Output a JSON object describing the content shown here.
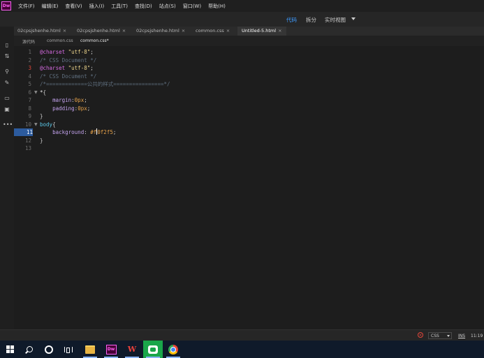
{
  "app": {
    "logo_text": "Dw"
  },
  "menubar": {
    "items": [
      "文件(F)",
      "编辑(E)",
      "查看(V)",
      "插入(I)",
      "工具(T)",
      "查找(D)",
      "站点(S)",
      "窗口(W)",
      "帮助(H)"
    ]
  },
  "viewbar": {
    "code_label": "代码",
    "split_label": "拆分",
    "live_label": "实时视图"
  },
  "tabs": [
    {
      "label": "02cpsjshenhe.html",
      "active": false
    },
    {
      "label": "02cpsjshenhe.html",
      "active": false
    },
    {
      "label": "02cpsjshenhe.html",
      "active": false
    },
    {
      "label": "common.css",
      "active": false
    },
    {
      "label": "Untitled-5.html",
      "active": true
    }
  ],
  "tab_close_glyph": "×",
  "related_files": {
    "source_label": "源代码",
    "items": [
      "common.css",
      "common.css*"
    ],
    "active_index": 1
  },
  "editor": {
    "current_line": 11,
    "error_line": 3,
    "lines": [
      {
        "num": "1",
        "fold": "",
        "parts": [
          [
            "c-at",
            "@charset"
          ],
          [
            "c-punc",
            " "
          ],
          [
            "c-str",
            "\"utf-8\""
          ],
          [
            "c-punc",
            ";"
          ]
        ]
      },
      {
        "num": "2",
        "fold": "",
        "parts": [
          [
            "c-com",
            "/* CSS Document */"
          ]
        ]
      },
      {
        "num": "3",
        "fold": "",
        "parts": [
          [
            "c-at",
            "@charset"
          ],
          [
            "c-punc",
            " "
          ],
          [
            "c-str",
            "\"utf-8\""
          ],
          [
            "c-punc",
            ";"
          ]
        ]
      },
      {
        "num": "4",
        "fold": "",
        "parts": [
          [
            "c-com",
            "/* CSS Document */"
          ]
        ]
      },
      {
        "num": "5",
        "fold": "",
        "parts": [
          [
            "c-com",
            "/*=============公共的样式================*/"
          ]
        ]
      },
      {
        "num": "6",
        "fold": "▼",
        "parts": [
          [
            "c-sel",
            "*"
          ],
          [
            "c-punc",
            "{"
          ]
        ]
      },
      {
        "num": "7",
        "fold": "",
        "parts": [
          [
            "c-punc",
            "    "
          ],
          [
            "c-prop",
            "margin"
          ],
          [
            "c-punc",
            ":"
          ],
          [
            "c-val",
            "0px"
          ],
          [
            "c-punc",
            ";"
          ]
        ]
      },
      {
        "num": "8",
        "fold": "",
        "parts": [
          [
            "c-punc",
            "    "
          ],
          [
            "c-prop",
            "padding"
          ],
          [
            "c-punc",
            ":"
          ],
          [
            "c-val",
            "0px"
          ],
          [
            "c-punc",
            ";"
          ]
        ]
      },
      {
        "num": "9",
        "fold": "",
        "parts": [
          [
            "c-punc",
            "}"
          ]
        ]
      },
      {
        "num": "10",
        "fold": "▼",
        "parts": [
          [
            "c-tag",
            "body"
          ],
          [
            "c-punc",
            "{"
          ]
        ]
      },
      {
        "num": "11",
        "fold": "",
        "parts": [
          [
            "c-punc",
            "    "
          ],
          [
            "c-prop",
            "background"
          ],
          [
            "c-punc",
            ": "
          ],
          [
            "c-val",
            "#f"
          ],
          [
            "cursor",
            ""
          ],
          [
            "c-val",
            "0f2f5"
          ],
          [
            "c-punc",
            ";"
          ]
        ]
      },
      {
        "num": "12",
        "fold": "",
        "parts": [
          [
            "c-punc",
            "}"
          ]
        ]
      },
      {
        "num": "13",
        "fold": "",
        "parts": []
      }
    ]
  },
  "statusbar": {
    "language": "CSS",
    "ins_label": "INS",
    "position": "11:19"
  },
  "colors": {
    "accent": "#3e9bff",
    "error": "#e0463a",
    "current_line_bg": "#2c5b9e"
  },
  "taskbar": {
    "items": [
      "windows-start",
      "search",
      "cortana",
      "task-view",
      "file-explorer",
      "dreamweaver",
      "wps-office",
      "wechat",
      "chrome"
    ],
    "dw_text": "Dw",
    "wps_text": "W"
  }
}
